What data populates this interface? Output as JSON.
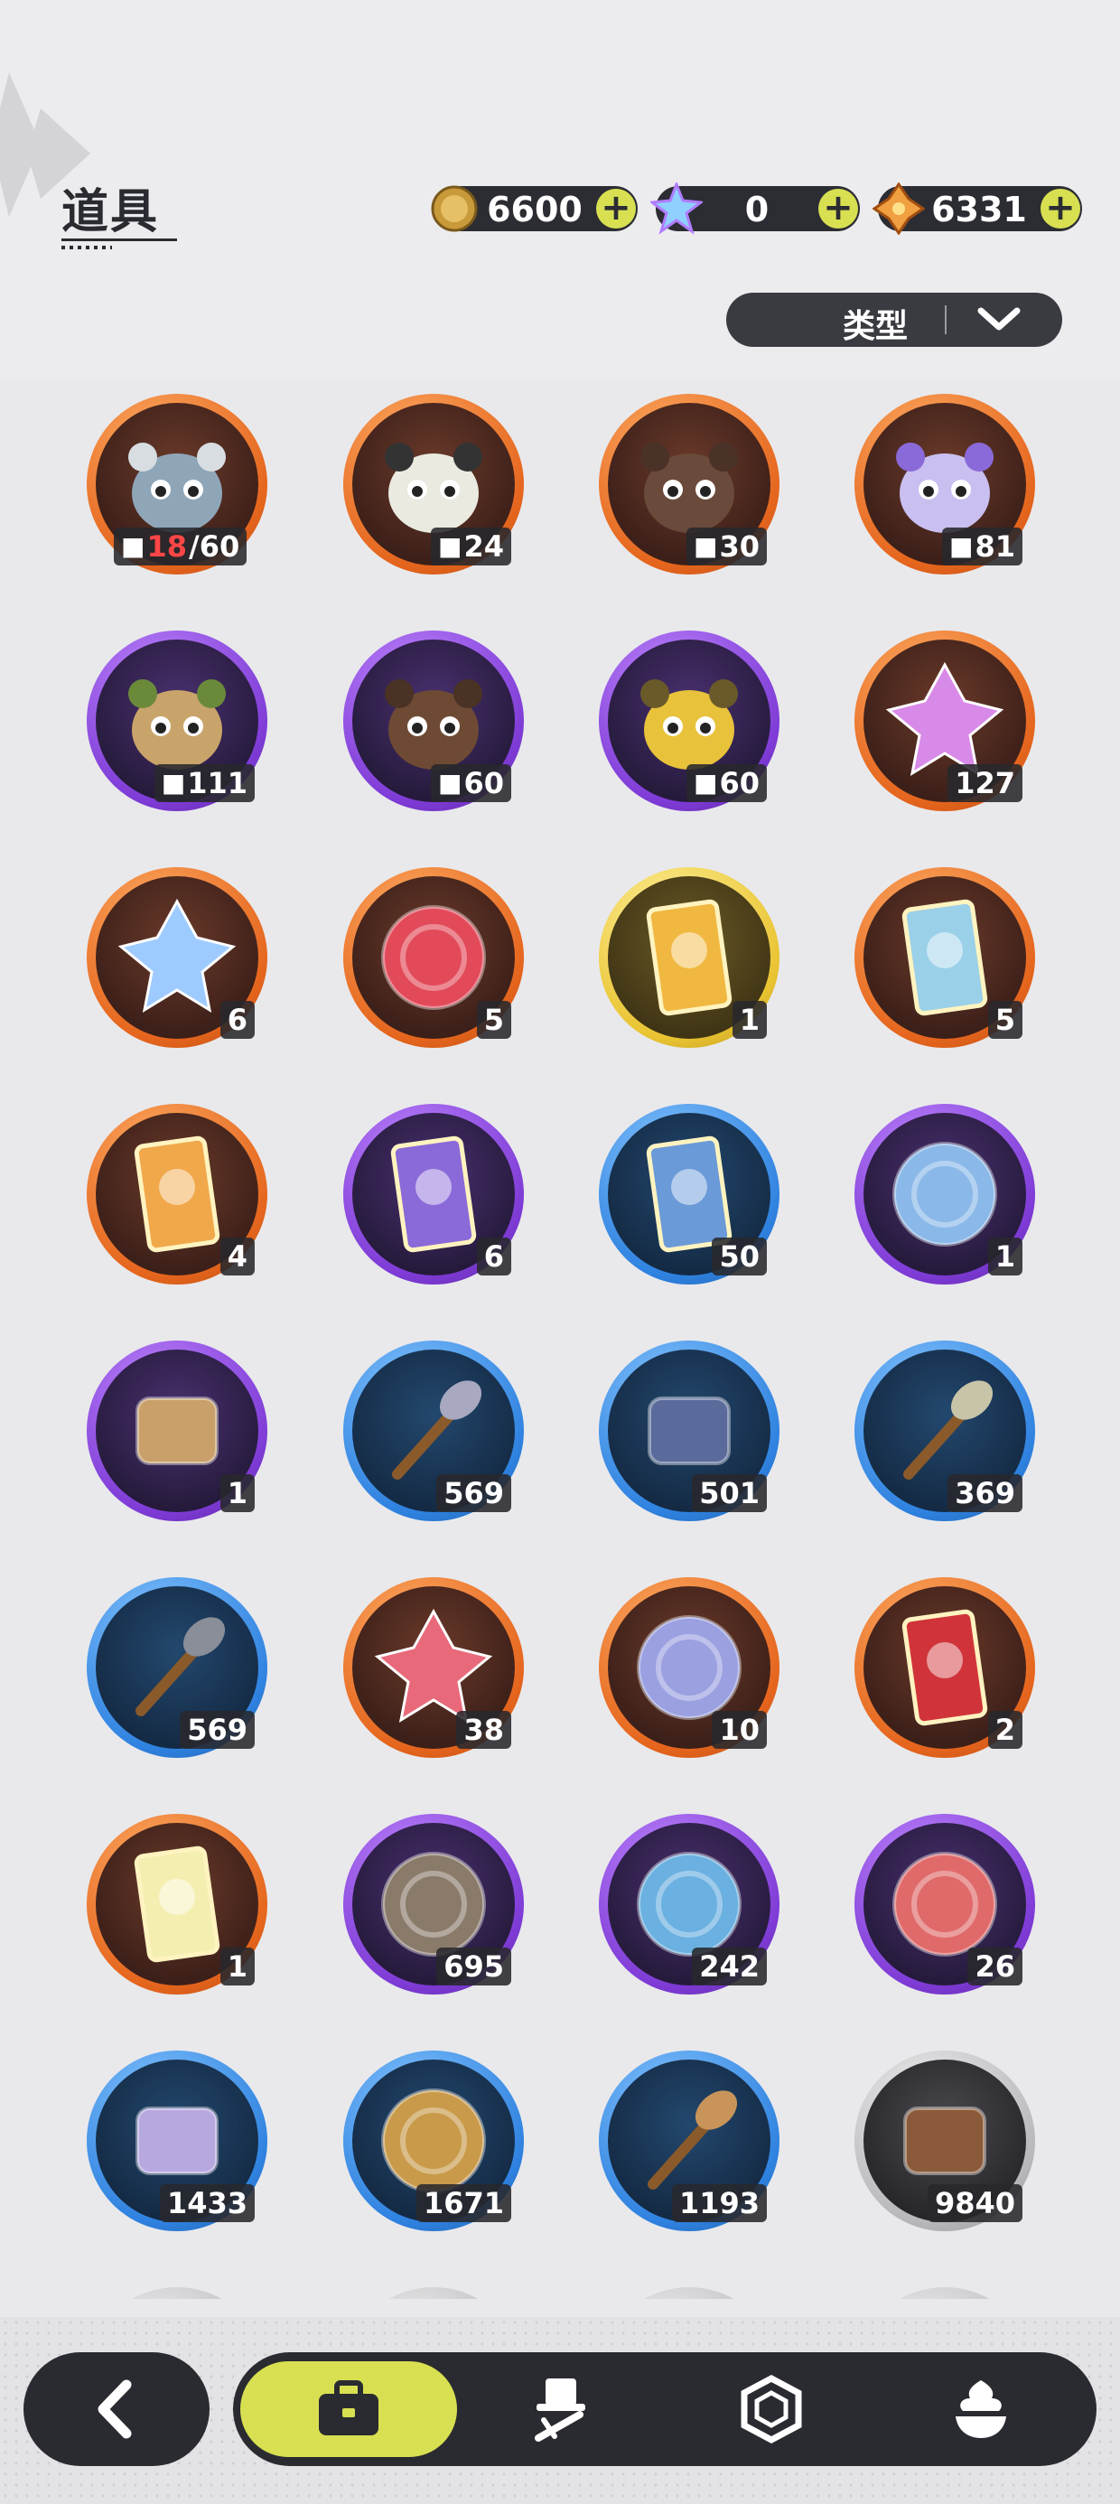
{
  "header": {
    "title": "道具",
    "currencies": [
      {
        "icon": "gold-coin-icon",
        "amount": "6600",
        "plus": "+"
      },
      {
        "icon": "crystal-star-icon",
        "amount": "0",
        "plus": "+"
      },
      {
        "icon": "orange-gem-icon",
        "amount": "6331",
        "plus": "+"
      }
    ],
    "filter": {
      "label": "类型"
    }
  },
  "items": [
    {
      "icon": "knight-creature-icon",
      "rarity": "orange",
      "count": "18/60",
      "count_owned": "18",
      "count_total": "/60",
      "shard": true
    },
    {
      "icon": "panda-creature-icon",
      "rarity": "orange",
      "count": "24",
      "shard": true
    },
    {
      "icon": "brown-bear-creature-icon",
      "rarity": "orange",
      "count": "30",
      "shard": true
    },
    {
      "icon": "purple-fox-creature-icon",
      "rarity": "orange",
      "count": "81",
      "shard": true
    },
    {
      "icon": "sprout-creature-icon",
      "rarity": "purple",
      "count": "111",
      "shard": true
    },
    {
      "icon": "boar-creature-icon",
      "rarity": "purple",
      "count": "60",
      "shard": true
    },
    {
      "icon": "chick-creature-icon",
      "rarity": "purple",
      "count": "60",
      "shard": true
    },
    {
      "icon": "pink-crystal-icon",
      "rarity": "orange",
      "count": "127",
      "shard": false
    },
    {
      "icon": "blue-crystal-icon",
      "rarity": "orange",
      "count": "6",
      "shard": false
    },
    {
      "icon": "paw-pendant-icon",
      "rarity": "orange",
      "count": "5",
      "shard": false
    },
    {
      "icon": "gold-card-icon",
      "rarity": "gold",
      "count": "1",
      "shard": false
    },
    {
      "icon": "rainbow-card-icon",
      "rarity": "orange",
      "count": "5",
      "shard": false
    },
    {
      "icon": "orange-card-icon",
      "rarity": "orange",
      "count": "4",
      "shard": false
    },
    {
      "icon": "purple-card-icon",
      "rarity": "purple",
      "count": "6",
      "shard": false
    },
    {
      "icon": "blue-card-icon",
      "rarity": "blue",
      "count": "50",
      "shard": false
    },
    {
      "icon": "mirror-icon",
      "rarity": "purple",
      "count": "1",
      "shard": false
    },
    {
      "icon": "scroll-icon",
      "rarity": "purple",
      "count": "1",
      "shard": false
    },
    {
      "icon": "shovel-icon",
      "rarity": "blue",
      "count": "569",
      "shard": false
    },
    {
      "icon": "boxing-glove-icon",
      "rarity": "blue",
      "count": "501",
      "shard": false
    },
    {
      "icon": "pickaxe-icon",
      "rarity": "blue",
      "count": "369",
      "shard": false
    },
    {
      "icon": "hammer-icon",
      "rarity": "blue",
      "count": "569",
      "shard": false
    },
    {
      "icon": "ruby-fruit-icon",
      "rarity": "orange",
      "count": "38",
      "shard": false
    },
    {
      "icon": "shirt-token-icon",
      "rarity": "orange",
      "count": "10",
      "shard": false
    },
    {
      "icon": "ticket-icon",
      "rarity": "orange",
      "count": "2",
      "shard": false
    },
    {
      "icon": "rainbow-ticket-icon",
      "rarity": "orange",
      "count": "1",
      "shard": false
    },
    {
      "icon": "fist-token-icon",
      "rarity": "purple",
      "count": "695",
      "shard": false
    },
    {
      "icon": "blue-rune-token-icon",
      "rarity": "purple",
      "count": "242",
      "shard": false
    },
    {
      "icon": "heart-token-icon",
      "rarity": "purple",
      "count": "26",
      "shard": false
    },
    {
      "icon": "scale-shell-icon",
      "rarity": "blue",
      "count": "1433",
      "shard": false
    },
    {
      "icon": "gear-icon",
      "rarity": "blue",
      "count": "1671",
      "shard": false
    },
    {
      "icon": "leaf-icon",
      "rarity": "blue",
      "count": "1193",
      "shard": false
    },
    {
      "icon": "wood-logs-icon",
      "rarity": "gray",
      "count": "9840",
      "shard": false
    }
  ],
  "nav": {
    "back": "back-arrow-icon",
    "tabs": [
      {
        "icon": "bag-icon",
        "active": true
      },
      {
        "icon": "hat-sword-icon",
        "active": false
      },
      {
        "icon": "hexagon-gem-icon",
        "active": false
      },
      {
        "icon": "dessert-icon",
        "active": false
      }
    ]
  },
  "colors": {
    "accent": "#d8e052",
    "dark": "#2a2b30",
    "orange": "#e5651d",
    "purple": "#7e3bd6",
    "blue": "#2f82e0",
    "gold": "#e9c331",
    "gray": "#b8b8bc"
  }
}
